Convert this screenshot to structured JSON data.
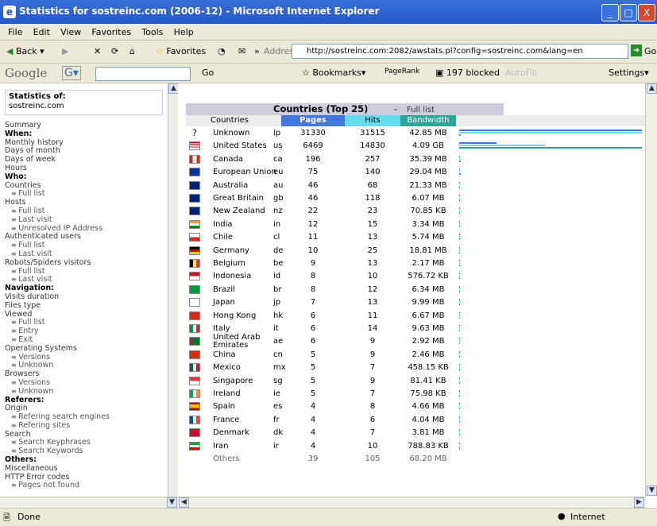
{
  "window": {
    "title": "Statistics for sostreinc.com (2006-12) - Microsoft Internet Explorer",
    "minimize": "_",
    "maximize": "□",
    "close": "X"
  },
  "menu": [
    "File",
    "Edit",
    "View",
    "Favorites",
    "Tools",
    "Help"
  ],
  "toolbar": {
    "back": "Back",
    "favorites": "Favorites",
    "address_label": "Address",
    "address_url": "http://sostreinc.com:2082/awstats.pl?config=sostreinc.com&lang=en",
    "go": "Go"
  },
  "google_toolbar": {
    "logo": "Google",
    "go": "Go",
    "bookmarks": "Bookmarks",
    "pagerank": "PageRank",
    "blocked": "197 blocked",
    "autofill": "AutoFill",
    "settings": "Settings"
  },
  "left": {
    "stats_of_label": "Statistics of:",
    "site": "sostreinc.com",
    "nav": [
      {
        "t": "Summary",
        "c": "item"
      },
      {
        "t": "When:",
        "c": "sec"
      },
      {
        "t": "Monthly history",
        "c": "item"
      },
      {
        "t": "Days of month",
        "c": "item"
      },
      {
        "t": "Days of week",
        "c": "item"
      },
      {
        "t": "Hours",
        "c": "item"
      },
      {
        "t": "Who:",
        "c": "sec"
      },
      {
        "t": "Countries",
        "c": "item"
      },
      {
        "t": "Full list",
        "c": "sub"
      },
      {
        "t": "Hosts",
        "c": "item"
      },
      {
        "t": "Full list",
        "c": "sub"
      },
      {
        "t": "Last visit",
        "c": "sub"
      },
      {
        "t": "Unresolved IP Address",
        "c": "sub"
      },
      {
        "t": "Authenticated users",
        "c": "item"
      },
      {
        "t": "Full list",
        "c": "sub"
      },
      {
        "t": "Last visit",
        "c": "sub"
      },
      {
        "t": "Robots/Spiders visitors",
        "c": "item"
      },
      {
        "t": "Full list",
        "c": "sub"
      },
      {
        "t": "Last visit",
        "c": "sub"
      },
      {
        "t": "Navigation:",
        "c": "sec"
      },
      {
        "t": "Visits duration",
        "c": "item"
      },
      {
        "t": "Files type",
        "c": "item"
      },
      {
        "t": "Viewed",
        "c": "item"
      },
      {
        "t": "Full list",
        "c": "sub"
      },
      {
        "t": "Entry",
        "c": "sub"
      },
      {
        "t": "Exit",
        "c": "sub"
      },
      {
        "t": "Operating Systems",
        "c": "item"
      },
      {
        "t": "Versions",
        "c": "sub"
      },
      {
        "t": "Unknown",
        "c": "sub"
      },
      {
        "t": "Browsers",
        "c": "item"
      },
      {
        "t": "Versions",
        "c": "sub"
      },
      {
        "t": "Unknown",
        "c": "sub"
      },
      {
        "t": "Referers:",
        "c": "sec"
      },
      {
        "t": "Origin",
        "c": "item"
      },
      {
        "t": "Refering search engines",
        "c": "sub"
      },
      {
        "t": "Refering sites",
        "c": "sub"
      },
      {
        "t": "Search",
        "c": "item"
      },
      {
        "t": "Search Keyphrases",
        "c": "sub"
      },
      {
        "t": "Search Keywords",
        "c": "sub"
      },
      {
        "t": "Others:",
        "c": "sec"
      },
      {
        "t": "Miscellaneous",
        "c": "item"
      },
      {
        "t": "HTTP Error codes",
        "c": "item"
      },
      {
        "t": "Pages not found",
        "c": "sub"
      }
    ]
  },
  "main": {
    "panel_title": "Countries (Top 25)",
    "dash": "-",
    "full_list": "Full list",
    "headers": {
      "countries": "Countries",
      "pages": "Pages",
      "hits": "Hits",
      "bandwidth": "Bandwidth"
    },
    "header_colors": {
      "pages": "#4477dd",
      "hits": "#66ddee",
      "bandwidth": "#2ea495"
    },
    "rows": [
      {
        "name": "Unknown",
        "code": "ip",
        "pages": "31330",
        "hits": "31515",
        "bw": "42.85 MB",
        "flag": "?",
        "p": 1.0,
        "h": 1.0,
        "b": 0.0105
      },
      {
        "name": "United States",
        "code": "us",
        "pages": "6469",
        "hits": "14830",
        "bw": "4.09 GB",
        "flag": "us",
        "p": 0.206,
        "h": 0.47,
        "b": 1.0
      },
      {
        "name": "Canada",
        "code": "ca",
        "pages": "196",
        "hits": "257",
        "bw": "35.39 MB",
        "flag": "ca",
        "p": 0.006,
        "h": 0.008,
        "b": 0.008
      },
      {
        "name": "European Union",
        "code": "eu",
        "pages": "75",
        "hits": "140",
        "bw": "29.04 MB",
        "flag": "eu",
        "p": 0.002,
        "h": 0.004,
        "b": 0.007
      },
      {
        "name": "Australia",
        "code": "au",
        "pages": "46",
        "hits": "68",
        "bw": "21.33 MB",
        "flag": "au",
        "p": 0.0015,
        "h": 0.002,
        "b": 0.005
      },
      {
        "name": "Great Britain",
        "code": "gb",
        "pages": "46",
        "hits": "118",
        "bw": "6.07 MB",
        "flag": "gb",
        "p": 0.0015,
        "h": 0.004,
        "b": 0.0015
      },
      {
        "name": "New Zealand",
        "code": "nz",
        "pages": "22",
        "hits": "23",
        "bw": "70.85 KB",
        "flag": "nz",
        "p": 0.0007,
        "h": 0.0007,
        "b": 0.0001
      },
      {
        "name": "India",
        "code": "in",
        "pages": "12",
        "hits": "15",
        "bw": "3.34 MB",
        "flag": "in",
        "p": 0.0004,
        "h": 0.0005,
        "b": 0.0008
      },
      {
        "name": "Chile",
        "code": "cl",
        "pages": "11",
        "hits": "13",
        "bw": "5.74 MB",
        "flag": "cl",
        "p": 0.0004,
        "h": 0.0004,
        "b": 0.0014
      },
      {
        "name": "Germany",
        "code": "de",
        "pages": "10",
        "hits": "25",
        "bw": "18.81 MB",
        "flag": "de",
        "p": 0.0003,
        "h": 0.0008,
        "b": 0.0045
      },
      {
        "name": "Belgium",
        "code": "be",
        "pages": "9",
        "hits": "13",
        "bw": "2.17 MB",
        "flag": "be",
        "p": 0.0003,
        "h": 0.0004,
        "b": 0.0005
      },
      {
        "name": "Indonesia",
        "code": "id",
        "pages": "8",
        "hits": "10",
        "bw": "576.72 KB",
        "flag": "id",
        "p": 0.0003,
        "h": 0.0003,
        "b": 0.0001
      },
      {
        "name": "Brazil",
        "code": "br",
        "pages": "8",
        "hits": "12",
        "bw": "6.34 MB",
        "flag": "br",
        "p": 0.0003,
        "h": 0.0004,
        "b": 0.0015
      },
      {
        "name": "Japan",
        "code": "jp",
        "pages": "7",
        "hits": "13",
        "bw": "9.99 MB",
        "flag": "jp",
        "p": 0.0002,
        "h": 0.0004,
        "b": 0.0024
      },
      {
        "name": "Hong Kong",
        "code": "hk",
        "pages": "6",
        "hits": "11",
        "bw": "6.67 MB",
        "flag": "hk",
        "p": 0.0002,
        "h": 0.0003,
        "b": 0.0016
      },
      {
        "name": "Italy",
        "code": "it",
        "pages": "6",
        "hits": "14",
        "bw": "9.63 MB",
        "flag": "it",
        "p": 0.0002,
        "h": 0.0004,
        "b": 0.0023
      },
      {
        "name": "United Arab Emirates",
        "code": "ae",
        "pages": "6",
        "hits": "9",
        "bw": "2.92 MB",
        "flag": "ae",
        "p": 0.0002,
        "h": 0.0003,
        "b": 0.0007
      },
      {
        "name": "China",
        "code": "cn",
        "pages": "5",
        "hits": "9",
        "bw": "2.46 MB",
        "flag": "cn",
        "p": 0.0002,
        "h": 0.0003,
        "b": 0.0006
      },
      {
        "name": "Mexico",
        "code": "mx",
        "pages": "5",
        "hits": "7",
        "bw": "458.15 KB",
        "flag": "mx",
        "p": 0.0002,
        "h": 0.0002,
        "b": 0.0001
      },
      {
        "name": "Singapore",
        "code": "sg",
        "pages": "5",
        "hits": "9",
        "bw": "81.41 KB",
        "flag": "sg",
        "p": 0.0002,
        "h": 0.0003,
        "b": 0.0001
      },
      {
        "name": "Ireland",
        "code": "ie",
        "pages": "5",
        "hits": "7",
        "bw": "75.98 KB",
        "flag": "ie",
        "p": 0.0002,
        "h": 0.0002,
        "b": 0.0001
      },
      {
        "name": "Spain",
        "code": "es",
        "pages": "4",
        "hits": "8",
        "bw": "4.66 MB",
        "flag": "es",
        "p": 0.0001,
        "h": 0.0003,
        "b": 0.0011
      },
      {
        "name": "France",
        "code": "fr",
        "pages": "4",
        "hits": "6",
        "bw": "4.04 MB",
        "flag": "fr",
        "p": 0.0001,
        "h": 0.0002,
        "b": 0.001
      },
      {
        "name": "Denmark",
        "code": "dk",
        "pages": "4",
        "hits": "7",
        "bw": "3.81 MB",
        "flag": "dk",
        "p": 0.0001,
        "h": 0.0002,
        "b": 0.0009
      },
      {
        "name": "Iran",
        "code": "ir",
        "pages": "4",
        "hits": "10",
        "bw": "788.83 KB",
        "flag": "ir",
        "p": 0.0001,
        "h": 0.0003,
        "b": 0.0002
      }
    ],
    "others": {
      "name": "Others",
      "pages": "39",
      "hits": "105",
      "bw": "68.20 MB"
    }
  },
  "status": {
    "done": "Done",
    "zone": "Internet"
  }
}
